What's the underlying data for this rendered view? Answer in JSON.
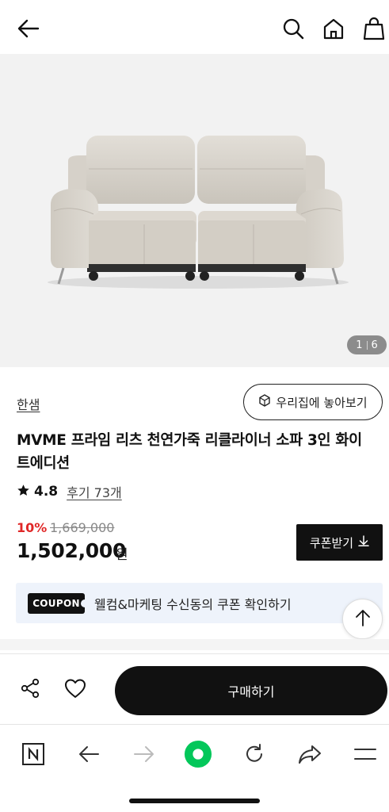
{
  "topbar": {
    "icons": [
      "back-arrow-icon",
      "search-icon",
      "home-icon",
      "shopping-bag-icon"
    ]
  },
  "gallery": {
    "current": "1",
    "total": "6"
  },
  "product": {
    "brand": "한샘",
    "ar_button": "우리집에 놓아보기",
    "title": "MVME 프라임 리츠 천연가죽 리클라이너 소파 3인 화이트에디션",
    "rating": "4.8",
    "reviews": "후기 73개",
    "discount": "10%",
    "original_price": "1,669,000",
    "price": "1,502,000",
    "currency": "원",
    "coupon_button": "쿠폰받기"
  },
  "coupon": {
    "tag": "COUPON",
    "text": "웰컴&마케팅 수신동의 쿠폰 확인하기"
  },
  "action": {
    "buy_button": "구매하기"
  },
  "browser": {
    "icons": [
      "naver-icon",
      "back-icon",
      "forward-icon",
      "green-dot-icon",
      "refresh-icon",
      "share-icon",
      "menu-icon"
    ]
  },
  "colors": {
    "discount": "#e02828",
    "coupon_bg": "#eef3fb",
    "primary": "#111111",
    "browser_green": "#03c75a"
  }
}
